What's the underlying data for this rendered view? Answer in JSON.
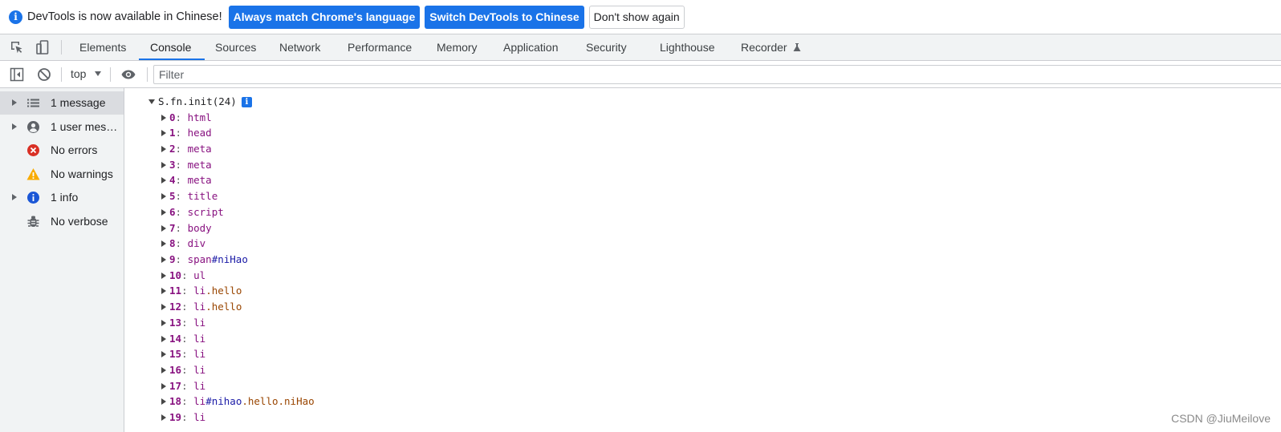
{
  "infobar": {
    "message": "DevTools is now available in Chinese!",
    "match_button": "Always match Chrome's language",
    "switch_button": "Switch DevTools to Chinese",
    "dismiss_button": "Don't show again"
  },
  "tabs": [
    {
      "label": "Elements"
    },
    {
      "label": "Console"
    },
    {
      "label": "Sources"
    },
    {
      "label": "Network"
    },
    {
      "label": "Performance"
    },
    {
      "label": "Memory"
    },
    {
      "label": "Application"
    },
    {
      "label": "Security"
    },
    {
      "label": "Lighthouse"
    },
    {
      "label": "Recorder"
    }
  ],
  "selected_tab": "Console",
  "console_toolbar": {
    "context": "top",
    "filter_placeholder": "Filter"
  },
  "sidebar": {
    "items": [
      {
        "label": "1 message",
        "icon": "list-icon",
        "expandable": true,
        "selected": true
      },
      {
        "label": "1 user mess…",
        "icon": "user-icon",
        "expandable": true,
        "selected": false
      },
      {
        "label": "No errors",
        "icon": "error-icon",
        "expandable": false,
        "selected": false
      },
      {
        "label": "No warnings",
        "icon": "warning-icon",
        "expandable": false,
        "selected": false
      },
      {
        "label": "1 info",
        "icon": "info-icon",
        "expandable": true,
        "selected": false
      },
      {
        "label": "No verbose",
        "icon": "bug-icon",
        "expandable": false,
        "selected": false
      }
    ]
  },
  "output": {
    "root": "S.fn.init(24)",
    "entries": [
      {
        "index": "0",
        "tag": "html",
        "id": "",
        "classes": ""
      },
      {
        "index": "1",
        "tag": "head",
        "id": "",
        "classes": ""
      },
      {
        "index": "2",
        "tag": "meta",
        "id": "",
        "classes": ""
      },
      {
        "index": "3",
        "tag": "meta",
        "id": "",
        "classes": ""
      },
      {
        "index": "4",
        "tag": "meta",
        "id": "",
        "classes": ""
      },
      {
        "index": "5",
        "tag": "title",
        "id": "",
        "classes": ""
      },
      {
        "index": "6",
        "tag": "script",
        "id": "",
        "classes": ""
      },
      {
        "index": "7",
        "tag": "body",
        "id": "",
        "classes": ""
      },
      {
        "index": "8",
        "tag": "div",
        "id": "",
        "classes": ""
      },
      {
        "index": "9",
        "tag": "span",
        "id": "#niHao",
        "classes": ""
      },
      {
        "index": "10",
        "tag": "ul",
        "id": "",
        "classes": ""
      },
      {
        "index": "11",
        "tag": "li",
        "id": "",
        "classes": ".hello"
      },
      {
        "index": "12",
        "tag": "li",
        "id": "",
        "classes": ".hello"
      },
      {
        "index": "13",
        "tag": "li",
        "id": "",
        "classes": ""
      },
      {
        "index": "14",
        "tag": "li",
        "id": "",
        "classes": ""
      },
      {
        "index": "15",
        "tag": "li",
        "id": "",
        "classes": ""
      },
      {
        "index": "16",
        "tag": "li",
        "id": "",
        "classes": ""
      },
      {
        "index": "17",
        "tag": "li",
        "id": "",
        "classes": ""
      },
      {
        "index": "18",
        "tag": "li",
        "id": "#nihao",
        "classes": ".hello.niHao"
      },
      {
        "index": "19",
        "tag": "li",
        "id": "",
        "classes": ""
      }
    ]
  },
  "watermark": "CSDN @JiuMeilove",
  "colors": {
    "accent": "#1a73e8",
    "property_key": "#881280",
    "tag_name": "#881280",
    "element_id": "#1a1aa6",
    "element_class": "#994500",
    "error": "#d93025",
    "warning": "#f9ab00"
  }
}
